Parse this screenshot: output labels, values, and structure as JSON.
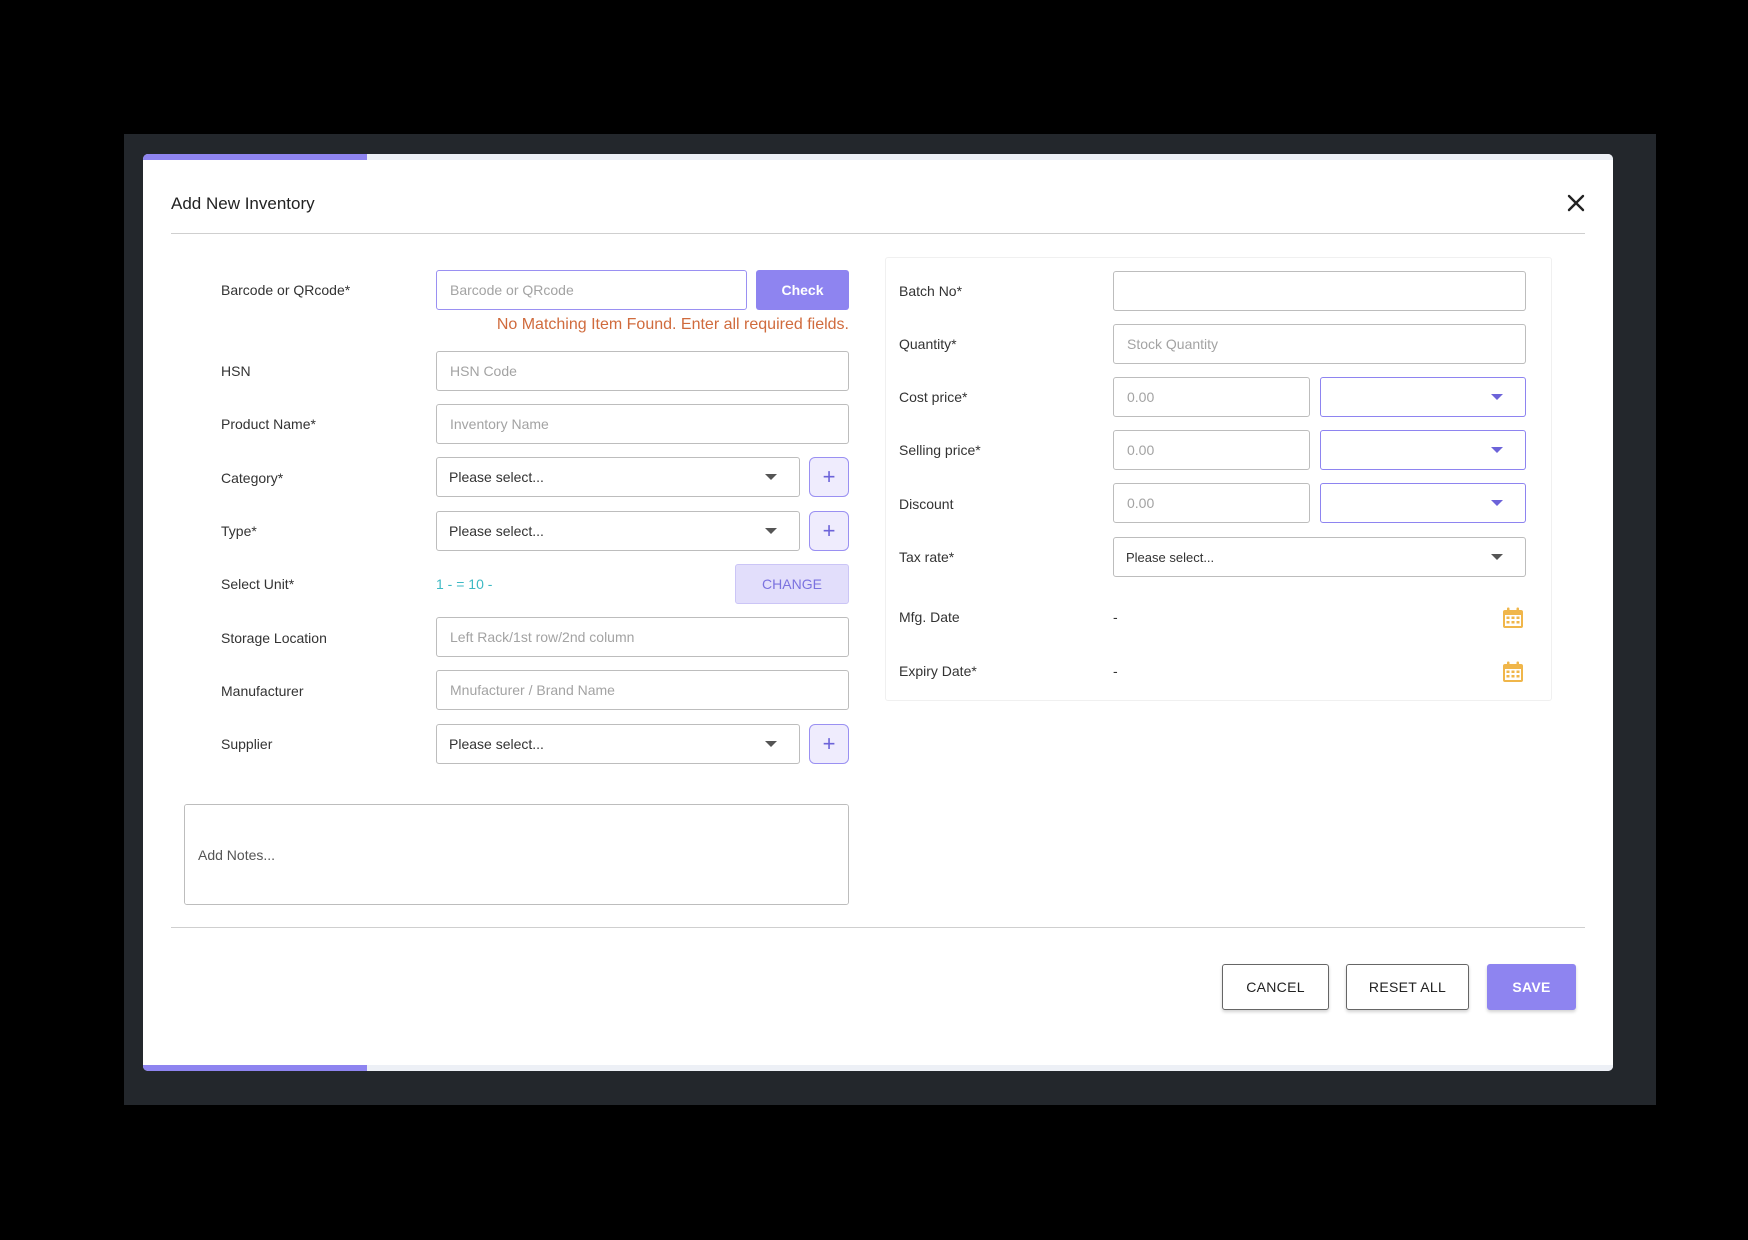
{
  "dialog": {
    "title": "Add New Inventory"
  },
  "left": {
    "barcode": {
      "label": "Barcode or QRcode*",
      "placeholder": "Barcode or QRcode",
      "check_label": "Check"
    },
    "error_message": "No Matching Item Found. Enter all required fields.",
    "hsn": {
      "label": "HSN",
      "placeholder": "HSN Code"
    },
    "product_name": {
      "label": "Product Name*",
      "placeholder": "Inventory Name"
    },
    "category": {
      "label": "Category*",
      "value": "Please select...",
      "add": "+"
    },
    "type": {
      "label": "Type*",
      "value": "Please select...",
      "add": "+"
    },
    "unit": {
      "label": "Select Unit*",
      "value": "1 - = 10 -",
      "change_label": "CHANGE"
    },
    "storage": {
      "label": "Storage Location",
      "placeholder": "Left Rack/1st row/2nd column"
    },
    "manufacturer": {
      "label": "Manufacturer",
      "placeholder": "Mnufacturer / Brand Name"
    },
    "supplier": {
      "label": "Supplier",
      "value": "Please select...",
      "add": "+"
    },
    "notes": {
      "placeholder": "Add Notes..."
    }
  },
  "right": {
    "batch_no": {
      "label": "Batch No*",
      "value": ""
    },
    "quantity": {
      "label": "Quantity*",
      "placeholder": "Stock Quantity"
    },
    "cost_price": {
      "label": "Cost price*",
      "placeholder": "0.00",
      "unit_value": ""
    },
    "selling_price": {
      "label": "Selling price*",
      "placeholder": "0.00",
      "unit_value": ""
    },
    "discount": {
      "label": "Discount",
      "placeholder": "0.00",
      "unit_value": ""
    },
    "tax_rate": {
      "label": "Tax rate*",
      "value": "Please select..."
    },
    "mfg_date": {
      "label": "Mfg. Date",
      "value": "-"
    },
    "expiry_date": {
      "label": "Expiry Date*",
      "value": "-"
    }
  },
  "footer": {
    "cancel": "CANCEL",
    "reset": "RESET ALL",
    "save": "SAVE"
  },
  "colors": {
    "accent": "#8e84f0",
    "error": "#d06b3d",
    "unit_text": "#3db9c4",
    "calendar": "#f0b64a"
  },
  "icons": {
    "close": "close-icon",
    "caret": "chevron-down-icon",
    "calendar": "calendar-icon",
    "add": "plus-icon"
  }
}
